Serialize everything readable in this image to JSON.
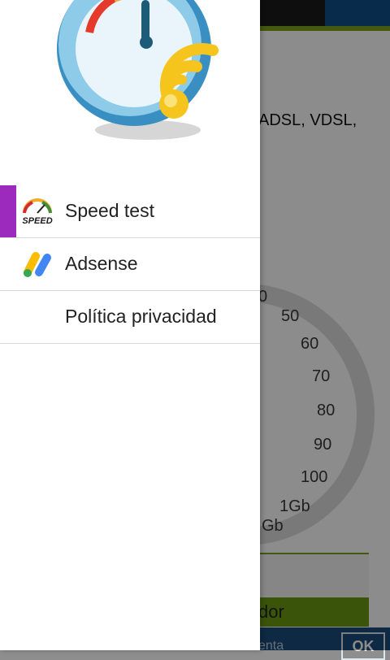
{
  "background_app": {
    "info_text": "ADSL, VDSL,",
    "gauge_ticks": [
      "0",
      "50",
      "60",
      "70",
      "80",
      "90",
      "100",
      "1Gb",
      "Gb"
    ],
    "button_label": "dor",
    "bottom_text": "enta",
    "ok_label": "OK"
  },
  "drawer": {
    "logo": "speedometer-wifi-logo",
    "items": [
      {
        "label": "Speed test",
        "icon": "speed-icon",
        "selected": true
      },
      {
        "label": "Adsense",
        "icon": "adsense-icon",
        "selected": false
      },
      {
        "label": "Política privacidad",
        "icon": "",
        "selected": false
      }
    ],
    "speed_icon_text": "SPEED"
  },
  "colors": {
    "accent": "#9c2bbd",
    "statusbar": "#1a1a1a",
    "app_green": "#7aa21a",
    "app_blue": "#1b4c7a"
  }
}
